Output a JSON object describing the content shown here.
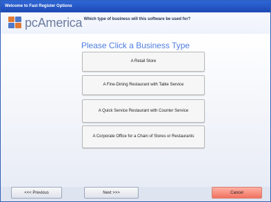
{
  "window": {
    "title": "Welcome to Fast Register Options"
  },
  "header": {
    "brand": "pcAmerica",
    "question": "Which type of business will this software be used for?"
  },
  "main": {
    "headline": "Please Click a Business Type",
    "choices": [
      {
        "label": "A Retail Store"
      },
      {
        "label": "A Fine-Dining Restaurant with Table Service"
      },
      {
        "label": "A Quick Service Restaurant with Counter Service"
      },
      {
        "label": "A Corporate Office for a Chain of Stores or Restaurants"
      }
    ]
  },
  "footer": {
    "previous": "<<< Previous",
    "next": "Next >>>",
    "cancel": "Cancel"
  }
}
